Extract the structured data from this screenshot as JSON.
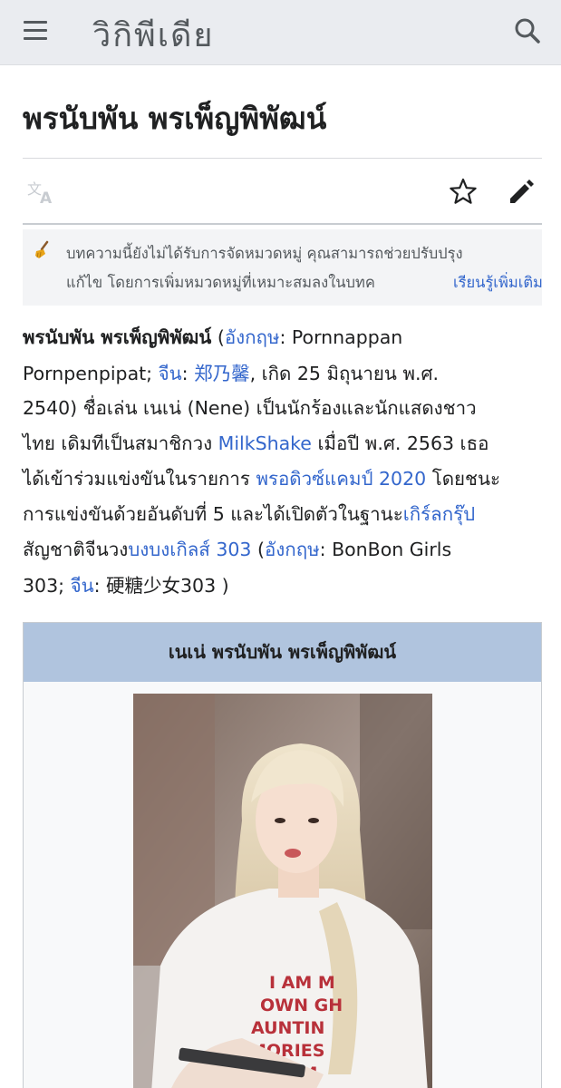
{
  "header": {
    "wordmark": "วิกิพีเดีย",
    "menu_icon": "hamburger-menu-icon",
    "search_icon": "search-icon"
  },
  "article": {
    "title": "พรนับพัน พรเพ็ญพิพัฒน์",
    "toolbar_icons": [
      "language-icon",
      "star-icon",
      "edit-pencil-icon"
    ]
  },
  "notice": {
    "line1": "บทความนี้ยังไม่ได้รับการจัดหมวดหมู่ คุณสามารถช่วยปรับปรุง",
    "line2": "แก้ไข โดยการเพิ่มหมวดหมู่ที่เหมาะสมลงในบทค",
    "more_link": "เรียนรู้เพิ่มเติม",
    "icon": "broom-icon"
  },
  "paragraph": {
    "l1_name": "พรนับพัน พรเพ็ญพิพัฒน์",
    "l1_paren": " (",
    "l1_english_link": "อังกฤษ",
    "l1_english_text": ": Pornnappan",
    "l2_text1": "Pornpenpipat; ",
    "l2_chinese_link": "จีน",
    "l2_colon": ": ",
    "l2_chinese_name": "郑乃馨",
    "l2_text2": ", เกิด 25 มิถุนายน พ.ศ.",
    "l3_text": "2540) ชื่อเล่น เนเน่ (Nene) เป็นนักร้องและนักแสดงชาว",
    "l4_text1": "ไทย เดิมทีเป็นสมาชิกวง ",
    "l4_milkshake": "MilkShake",
    "l4_text2": " เมื่อปี พ.ศ. 2563 เธอ",
    "l5_text1": "ได้เข้าร่วมแข่งขันในรายการ ",
    "l5_produce": "พรอดิวซ์แคมป์ 2020",
    "l5_text2": " โดยชนะ",
    "l6_text1": "การแข่งขันด้วยอันดับที่ 5 และได้เปิดตัวในฐานะ",
    "l6_girlgroup": "เกิร์ลกรุ๊ป",
    "l7_text1": "สัญชาติจีนวง",
    "l7_bonbon": "บงบงเกิลส์ 303",
    "l7_paren": " (",
    "l7_english_link": "อังกฤษ",
    "l7_english_text": ": BonBon Girls",
    "l8_text1": "303; ",
    "l8_chinese_link": "จีน",
    "l8_chinese_text": ": 硬糖少女303 )"
  },
  "infobox": {
    "title": "เนเน่ พรนับพัน พรเพ็ญพิพัฒน์",
    "shirt_text": [
      "I AM M",
      "OWN GH",
      "AUNTIN",
      "MORIES",
      "THE M"
    ]
  },
  "colors": {
    "header_bg": "#eaecf0",
    "link": "#3366cc",
    "infobox_header": "#b0c4de",
    "text": "#202122"
  }
}
